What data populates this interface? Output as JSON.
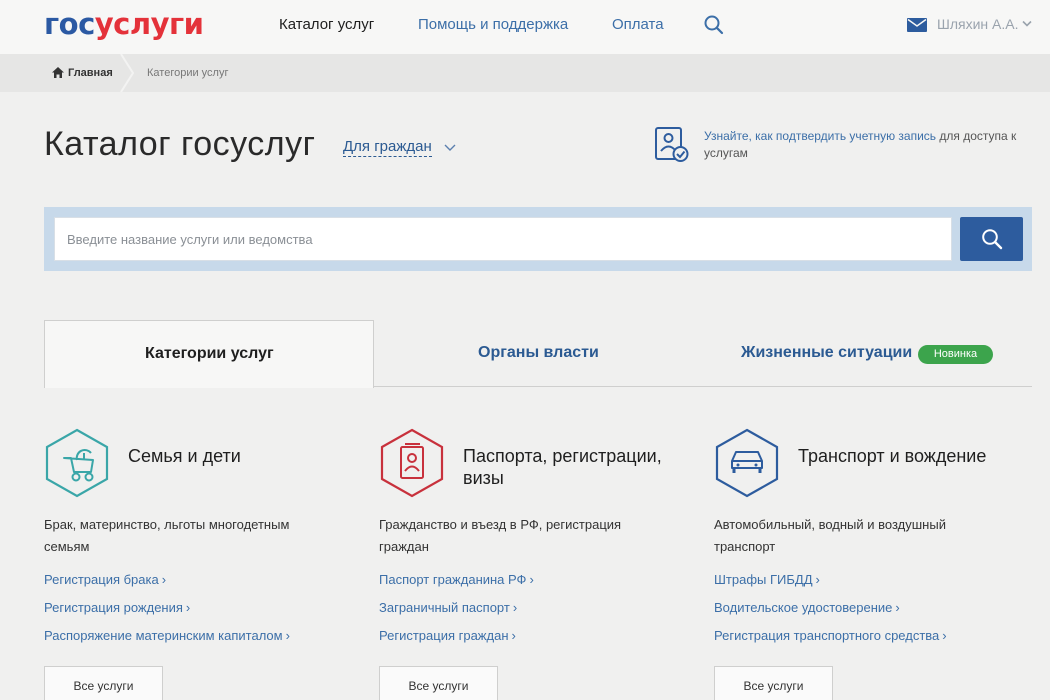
{
  "header": {
    "logo_part1": "гос",
    "logo_part2": "услуги",
    "nav": {
      "catalog": "Каталог услуг",
      "help": "Помощь и поддержка",
      "payment": "Оплата"
    },
    "user_name": "Шляхин А.А."
  },
  "breadcrumb": {
    "home": "Главная",
    "current": "Категории услуг"
  },
  "page": {
    "title": "Каталог госуслуг",
    "audience": "Для граждан",
    "confirm_link": "Узнайте, как подтвердить учетную запись",
    "confirm_rest": " для доступа к услугам"
  },
  "search": {
    "placeholder": "Введите название услуги или ведомства"
  },
  "tabs": {
    "categories": "Категории услуг",
    "authorities": "Органы власти",
    "life_situations": "Жизненные ситуации",
    "badge": "Новинка"
  },
  "categories": [
    {
      "title": "Семья и дети",
      "description": "Брак, материнство, льготы многодетным семьям",
      "links": [
        "Регистрация брака",
        "Регистрация рождения",
        "Распоряжение материнским капиталом"
      ],
      "all_label": "Все услуги",
      "color": "#3aa6a8"
    },
    {
      "title": "Паспорта, регистрации, визы",
      "description": "Гражданство и въезд в РФ, регистрация граждан",
      "links": [
        "Паспорт гражданина РФ",
        "Заграничный паспорт",
        "Регистрация граждан"
      ],
      "all_label": "Все услуги",
      "color": "#c8313c"
    },
    {
      "title": "Транспорт и вождение",
      "description": "Автомобильный, водный и воздушный транспорт",
      "links": [
        "Штрафы ГИБДД",
        "Водительское удостоверение",
        "Регистрация транспортного средства"
      ],
      "all_label": "Все услуги",
      "color": "#2d5c9e"
    }
  ],
  "icons": {
    "search": "search-icon",
    "mail": "mail-icon",
    "home": "home-icon",
    "family": "stroller-icon",
    "passport": "passport-icon",
    "transport": "car-icon",
    "confirm": "id-card-check-icon"
  },
  "colors": {
    "brand_blue": "#2b59a3",
    "brand_red": "#e4323a",
    "link": "#3c6fa8",
    "search_button": "#2d5c9e",
    "badge": "#3ca44c"
  }
}
